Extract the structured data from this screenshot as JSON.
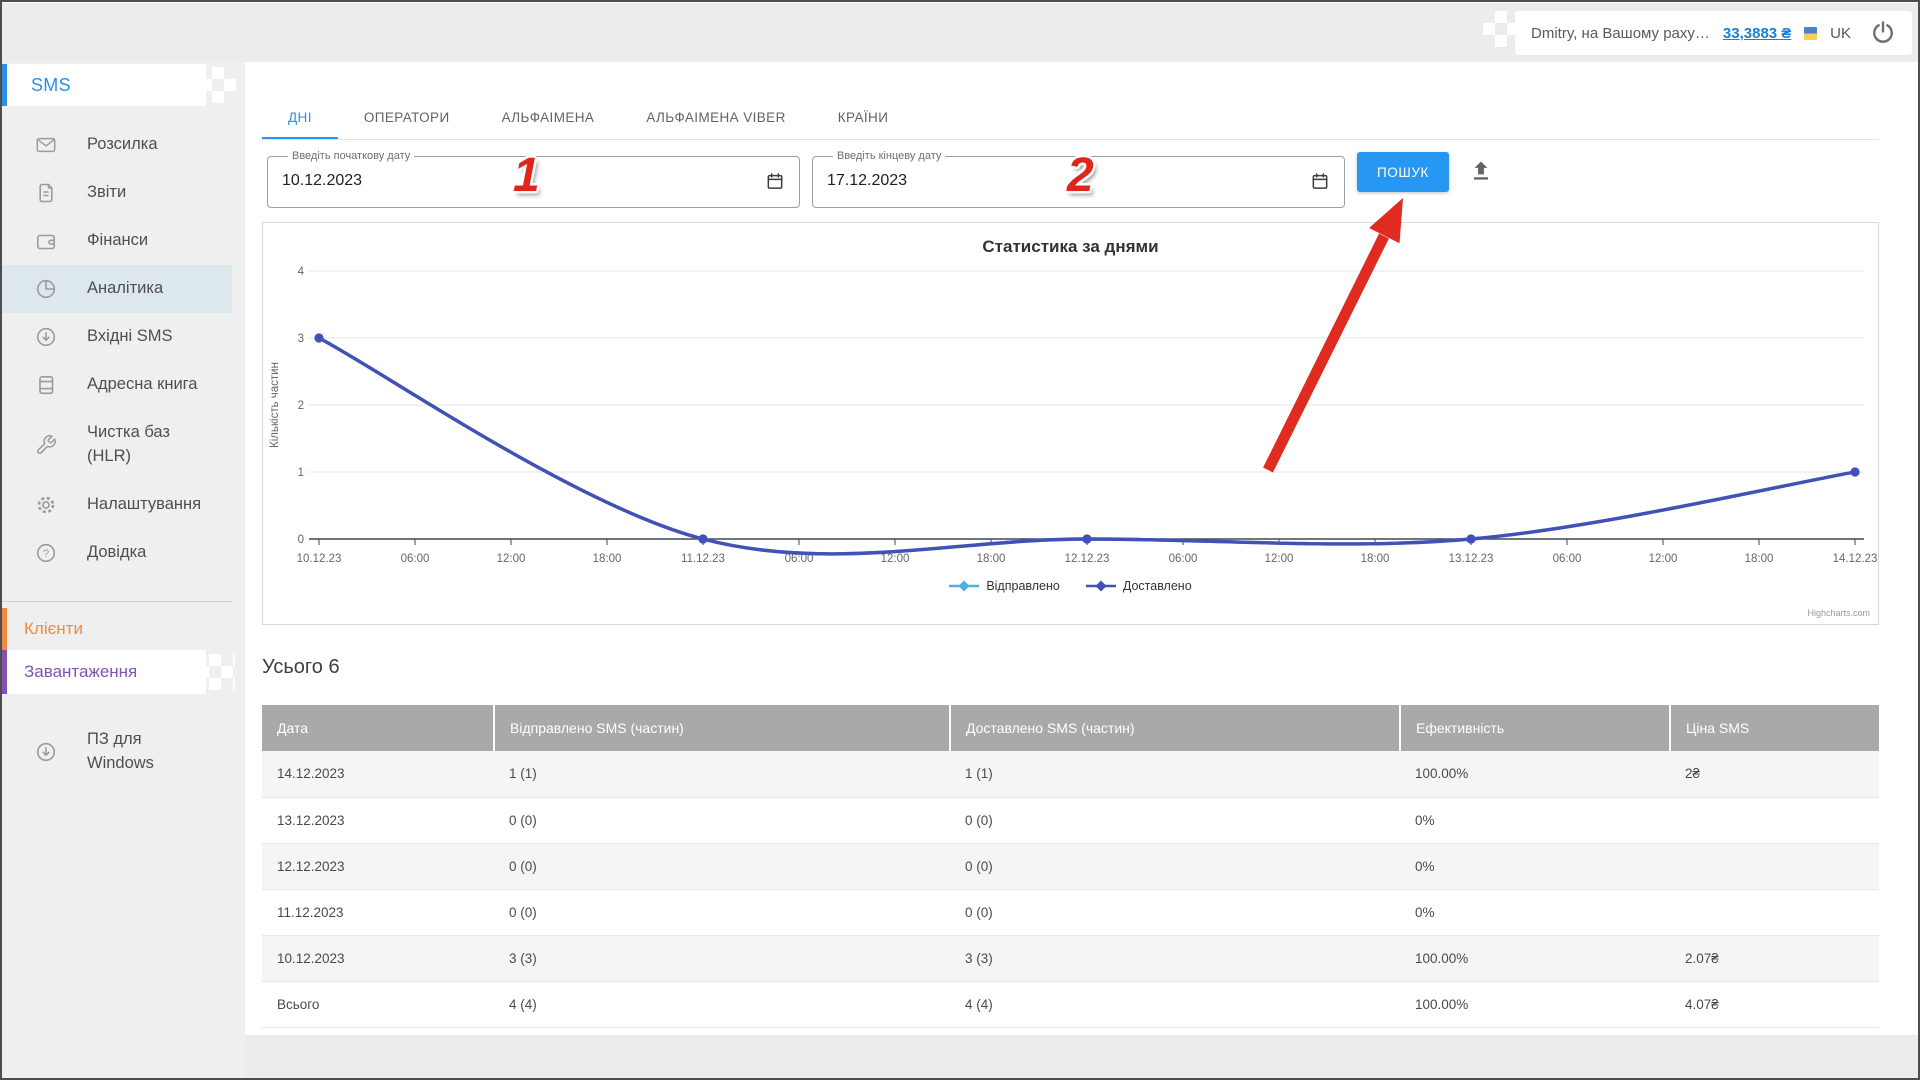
{
  "topbar": {
    "user_text": "Dmitry, на Вашому раху…",
    "balance": "33,3883 ₴",
    "language": "UK"
  },
  "sidebar": {
    "brand": "SMS",
    "items": [
      {
        "label": "Розсилка",
        "icon": "mail-icon"
      },
      {
        "label": "Звіти",
        "icon": "report-icon"
      },
      {
        "label": "Фінанси",
        "icon": "wallet-icon"
      },
      {
        "label": "Аналітика",
        "icon": "pie-chart-icon",
        "active": true
      },
      {
        "label": "Вхідні SMS",
        "icon": "incoming-sms-icon"
      },
      {
        "label": "Адресна книга",
        "icon": "address-book-icon"
      },
      {
        "label": "Чистка баз (HLR)",
        "icon": "wrench-icon"
      },
      {
        "label": "Налаштування",
        "icon": "gear-icon"
      },
      {
        "label": "Довідка",
        "icon": "help-icon"
      }
    ],
    "clients": "Клієнти",
    "downloads": "Завантаження",
    "windows_app": "ПЗ для Windows"
  },
  "tabs": [
    {
      "label": "ДНІ",
      "active": true
    },
    {
      "label": "ОПЕРАТОРИ",
      "active": false
    },
    {
      "label": "АЛЬФАІМЕНА",
      "active": false
    },
    {
      "label": "АЛЬФАІМЕНА VIBER",
      "active": false
    },
    {
      "label": "КРАЇНИ",
      "active": false
    }
  ],
  "filters": {
    "start_label": "Введіть початкову дату",
    "start_value": "10.12.2023",
    "end_label": "Введіть кінцеву дату",
    "end_value": "17.12.2023",
    "search_button": "ПОШУК",
    "annotation_1": "1",
    "annotation_2": "2"
  },
  "chart_data": {
    "type": "line",
    "title": "Статистика за днями",
    "ylabel": "Кількість частин",
    "ylim": [
      0,
      4
    ],
    "yticks": [
      0,
      1,
      2,
      3,
      4
    ],
    "grid": true,
    "legend_position": "bottom",
    "credits": "Highcharts.com",
    "x_tick_labels": [
      "10.12.23",
      "06:00",
      "12:00",
      "18:00",
      "11.12.23",
      "06:00",
      "12:00",
      "18:00",
      "12.12.23",
      "06:00",
      "12:00",
      "18:00",
      "13.12.23",
      "06:00",
      "12:00",
      "18:00",
      "14.12.23"
    ],
    "point_x_labels": [
      "10.12.23",
      "11.12.23",
      "12.12.23",
      "13.12.23",
      "14.12.23"
    ],
    "point_tick_indices": [
      0,
      4,
      8,
      12,
      16
    ],
    "series": [
      {
        "name": "Відправлено",
        "color": "#55aee2",
        "values": [
          3,
          0,
          0,
          0,
          1
        ]
      },
      {
        "name": "Доставлено",
        "color": "#4350b5",
        "values": [
          3,
          0,
          0,
          0,
          1
        ]
      }
    ]
  },
  "summary_title": "Усього 6",
  "table": {
    "columns": [
      "Дата",
      "Відправлено SMS (частин)",
      "Доставлено SMS (частин)",
      "Ефективність",
      "Ціна SMS"
    ],
    "rows": [
      [
        "14.12.2023",
        "1 (1)",
        "1 (1)",
        "100.00%",
        "2₴"
      ],
      [
        "13.12.2023",
        "0 (0)",
        "0 (0)",
        "0%",
        ""
      ],
      [
        "12.12.2023",
        "0 (0)",
        "0 (0)",
        "0%",
        ""
      ],
      [
        "11.12.2023",
        "0 (0)",
        "0 (0)",
        "0%",
        ""
      ],
      [
        "10.12.2023",
        "3 (3)",
        "3 (3)",
        "100.00%",
        "2.07₴"
      ],
      [
        "Всього",
        "4 (4)",
        "4 (4)",
        "100.00%",
        "4.07₴"
      ]
    ]
  }
}
